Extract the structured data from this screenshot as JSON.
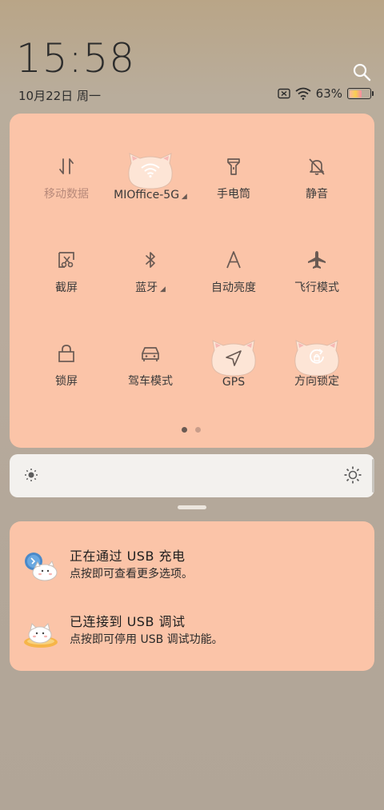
{
  "status_bar": {
    "time": "15:58",
    "date": "10月22日 周一",
    "battery_percent": "63%",
    "battery_level": 0.63,
    "icons": [
      "sim-off-icon",
      "wifi-icon",
      "battery-icon"
    ]
  },
  "quick_settings": {
    "tiles": [
      {
        "label": "移动数据",
        "icon": "mobile-data-icon",
        "active": false,
        "dim": true
      },
      {
        "label": "MIOffice-5G",
        "icon": "wifi-icon",
        "active": true,
        "has_menu": true
      },
      {
        "label": "手电筒",
        "icon": "flashlight-icon",
        "active": false
      },
      {
        "label": "静音",
        "icon": "mute-bell-icon",
        "active": false
      },
      {
        "label": "截屏",
        "icon": "screenshot-icon",
        "active": false
      },
      {
        "label": "蓝牙",
        "icon": "bluetooth-icon",
        "active": false,
        "has_menu": true
      },
      {
        "label": "自动亮度",
        "icon": "auto-brightness-icon",
        "active": false
      },
      {
        "label": "飞行模式",
        "icon": "airplane-icon",
        "active": false
      },
      {
        "label": "锁屏",
        "icon": "lock-icon",
        "active": false
      },
      {
        "label": "驾车模式",
        "icon": "car-icon",
        "active": false
      },
      {
        "label": "GPS",
        "icon": "gps-icon",
        "active": true
      },
      {
        "label": "方向锁定",
        "icon": "rotation-lock-icon",
        "active": true
      }
    ],
    "pages": 2,
    "current_page": 1
  },
  "brightness": {
    "level": 1.0
  },
  "notifications": [
    {
      "title": "正在通过 USB 充电",
      "subtitle": "点按即可查看更多选项。",
      "icon": "usb-charging-cat-icon"
    },
    {
      "title": "已连接到 USB 调试",
      "subtitle": "点按即可停用 USB 调试功能。",
      "icon": "usb-debug-cat-icon"
    }
  ],
  "colors": {
    "panel": "#fbc4a8",
    "icon_stroke": "#6a5a53",
    "active_cat": "#fde5d6"
  }
}
